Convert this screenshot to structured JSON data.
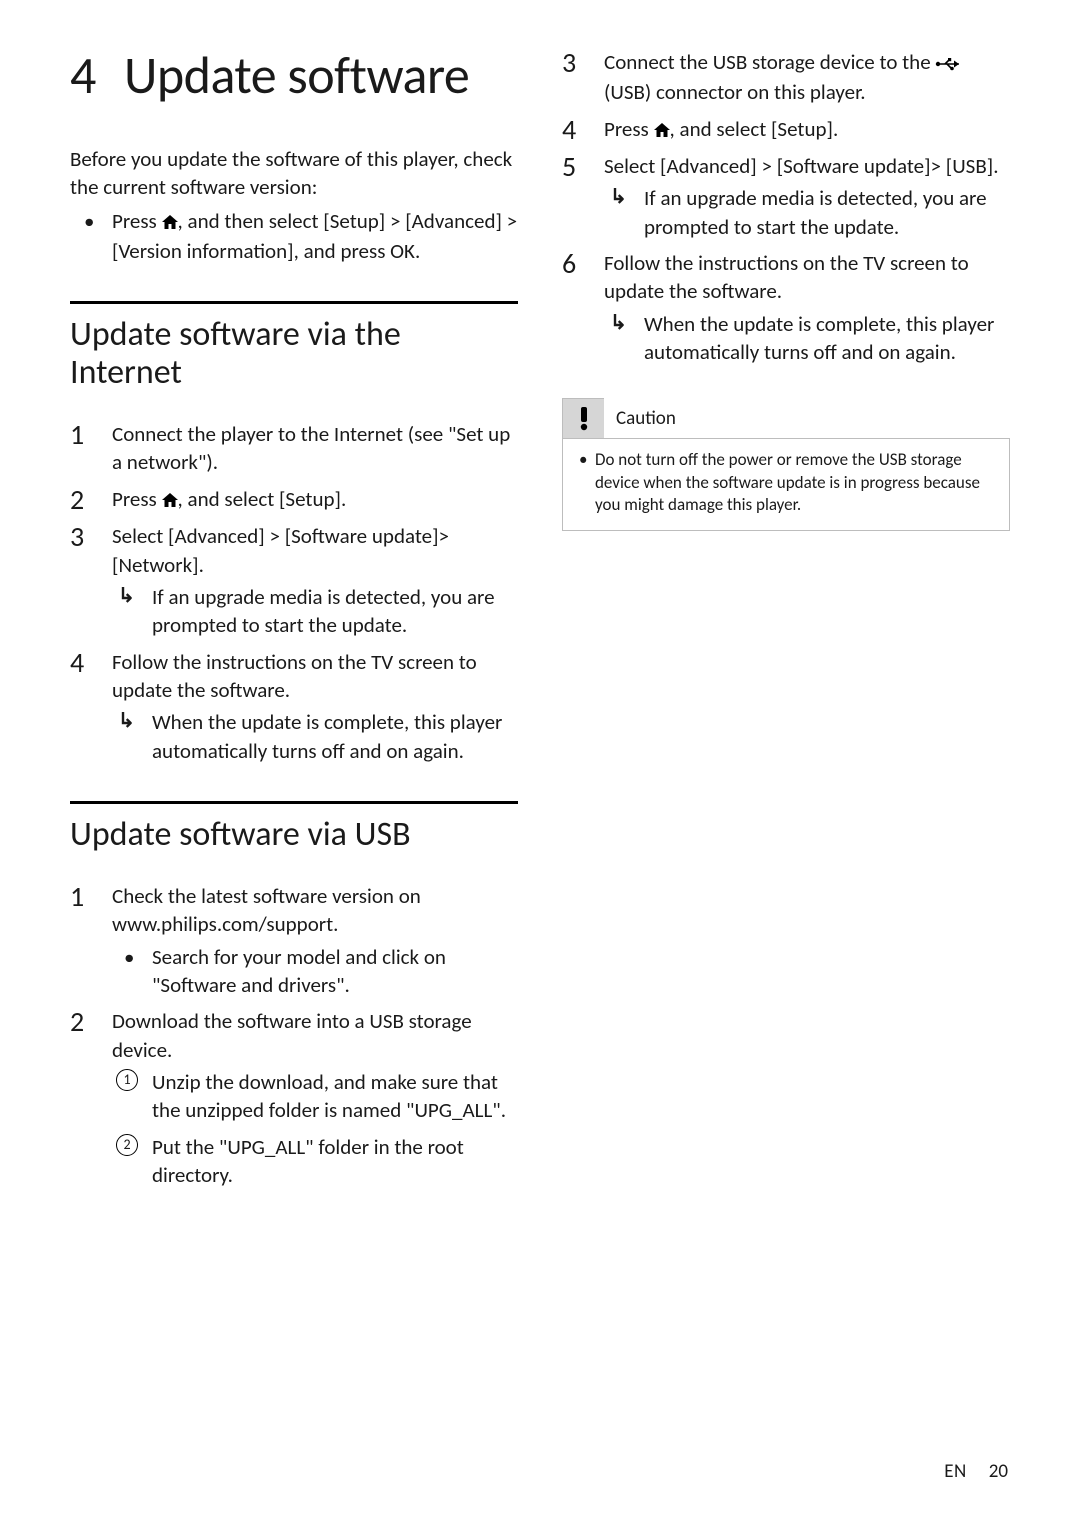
{
  "chapter": {
    "number": "4",
    "title": "Update software"
  },
  "intro": {
    "text": "Before you update the software of this player, check the current software version:",
    "bullet": {
      "pre": "Press ",
      "mid_1": ", and then select ",
      "setup": "[Setup]",
      "gt": " > ",
      "advanced": "[Advanced]",
      "version": "[Version information]",
      "mid_2": ", and press ",
      "ok": "OK",
      "post": "."
    }
  },
  "section_internet": {
    "title": "Update software via the Internet",
    "steps": {
      "s1": "Connect the player to the Internet (see \"Set up a network\").",
      "s2_pre": "Press ",
      "s2_mid": ", and select ",
      "s2_setup": "[Setup]",
      "s2_post": ".",
      "s3_pre": "Select ",
      "s3_adv": "[Advanced]",
      "s3_gt": " > ",
      "s3_sw": "[Software update]",
      "s3_gt2": "> ",
      "s3_net": "[Network]",
      "s3_post": ".",
      "s3_sub": "If an upgrade media is detected, you are prompted to start the update.",
      "s4": "Follow the instructions on the TV screen to update the software.",
      "s4_sub": "When the update is complete, this player automatically turns off and on again."
    }
  },
  "section_usb": {
    "title": "Update software via USB",
    "steps": {
      "s1": "Check the latest software version on www.philips.com/support.",
      "s1_sub": "Search for your model and click on \"Software and drivers\".",
      "s2": "Download the software into a USB storage device.",
      "s2_c1": "Unzip the download, and make sure that the unzipped folder is named \"UPG_ALL\".",
      "s2_c2": "Put the \"UPG_ALL\" folder in the root directory.",
      "s3_pre": "Connect the USB storage device to the ",
      "s3_usb": "(USB)",
      "s3_post": " connector on this player.",
      "s4_pre": "Press ",
      "s4_mid": ", and select ",
      "s4_setup": "[Setup]",
      "s4_post": ".",
      "s5_pre": "Select ",
      "s5_adv": "[Advanced]",
      "s5_gt": " > ",
      "s5_sw": "[Software update]",
      "s5_gt2": "> ",
      "s5_usb": "[USB]",
      "s5_post": ".",
      "s5_sub": "If an upgrade media is detected, you are prompted to start the update.",
      "s6": "Follow the instructions on the TV screen to update the software.",
      "s6_sub": "When the update is complete, this player automatically turns off and on again."
    }
  },
  "caution": {
    "title": "Caution",
    "text": "Do not turn off the power or remove the USB storage device when the software update is in progress because you might damage this player."
  },
  "footer": {
    "lang": "EN",
    "page": "20"
  }
}
